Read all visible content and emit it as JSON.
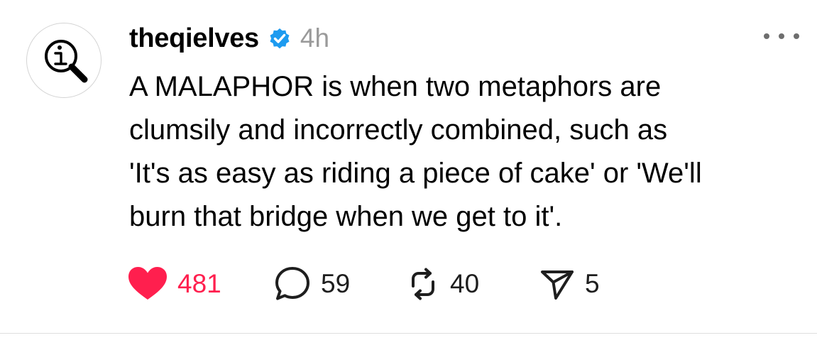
{
  "post": {
    "username": "theqielves",
    "verified": true,
    "timestamp": "4h",
    "text_lines": [
      "A MALAPHOR is when two metaphors are",
      "clumsily and incorrectly combined, such as",
      "'It's as easy as riding a piece of cake' or 'We'll",
      "burn that bridge when we get to it'."
    ],
    "avatar_icon": "info-magnifier-icon",
    "more_icon": "more-options-icon"
  },
  "actions": {
    "likes": {
      "count": "481",
      "icon": "heart-filled-icon",
      "color": "#ff1f4e"
    },
    "replies": {
      "count": "59",
      "icon": "comment-bubble-icon"
    },
    "reposts": {
      "count": "40",
      "icon": "repost-icon"
    },
    "shares": {
      "count": "5",
      "icon": "send-icon"
    }
  },
  "colors": {
    "verified_badge": "#1d9bf0",
    "timestamp": "#9a9a9a",
    "like_accent": "#ff1f4e",
    "divider": "#dedede"
  }
}
